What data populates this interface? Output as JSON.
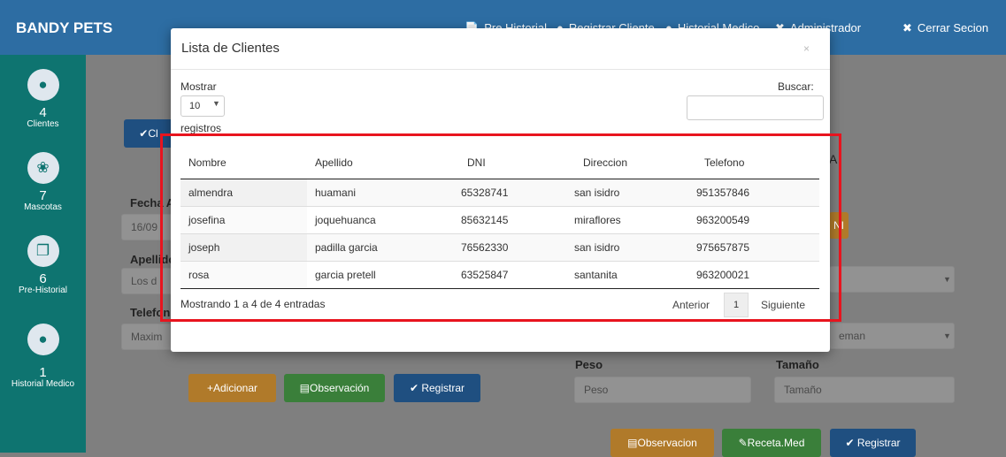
{
  "app": {
    "brand": "BANDY PETS"
  },
  "nav": {
    "items": [
      {
        "label": "Pre Historial",
        "icon": "document-icon"
      },
      {
        "label": "Registrar Cliente",
        "icon": "user-icon"
      },
      {
        "label": "Historial Medico",
        "icon": "user-medical-icon"
      },
      {
        "label": "Administrador",
        "icon": "wrench-icon"
      },
      {
        "label": "Cerrar Secion",
        "icon": "close-icon"
      }
    ]
  },
  "sidebar": {
    "items": [
      {
        "count": "4",
        "label": "Clientes",
        "icon": "user-icon"
      },
      {
        "count": "7",
        "label": "Mascotas",
        "icon": "paw-icon"
      },
      {
        "count": "6",
        "label": "Pre-Historial",
        "icon": "copy-icon"
      },
      {
        "count": "1",
        "label": "Historial Medico",
        "icon": "user-medical-icon"
      }
    ]
  },
  "background": {
    "clientes_btn": "Cl",
    "fecha_label": "Fecha A",
    "fecha_value": "16/09",
    "apellido_label": "Apellido",
    "apellido_placeholder": "Los d",
    "telefono_label": "Telefon",
    "telefono_placeholder": "Maxim",
    "raza_value": "eman",
    "peso_label": "Peso",
    "peso_placeholder": "Peso",
    "tamano_label": "Tamaño",
    "tamano_placeholder": "Tamaño",
    "adicionar": "Adicionar",
    "observacion": "Observación",
    "registrar": "Registrar",
    "observacion2": "Observacion",
    "receta": "Receta.Med",
    "registrar2": "Registrar",
    "partial_a": "A",
    "partial_ni": "NI"
  },
  "modal": {
    "title": "Lista de Clientes",
    "close": "×",
    "length_label": "Mostrar",
    "length_value": "10",
    "length_suffix": "registros",
    "search_label": "Buscar:",
    "columns": [
      "Nombre",
      "Apellido",
      "DNI",
      "Direccion",
      "Telefono"
    ],
    "rows": [
      [
        "almendra",
        "huamani",
        "65328741",
        "san isidro",
        "951357846"
      ],
      [
        "josefina",
        "joquehuanca",
        "85632145",
        "miraflores",
        "963200549"
      ],
      [
        "joseph",
        "padilla garcia",
        "76562330",
        "san isidro",
        "975657875"
      ],
      [
        "rosa",
        "garcia pretell",
        "63525847",
        "santanita",
        "963200021"
      ]
    ],
    "info": "Mostrando 1 a 4 de 4 entradas",
    "prev": "Anterior",
    "page": "1",
    "next": "Siguiente"
  },
  "colors": {
    "navbar": "#337ab7",
    "sidebar": "#139e98",
    "highlight": "#e8141e"
  }
}
